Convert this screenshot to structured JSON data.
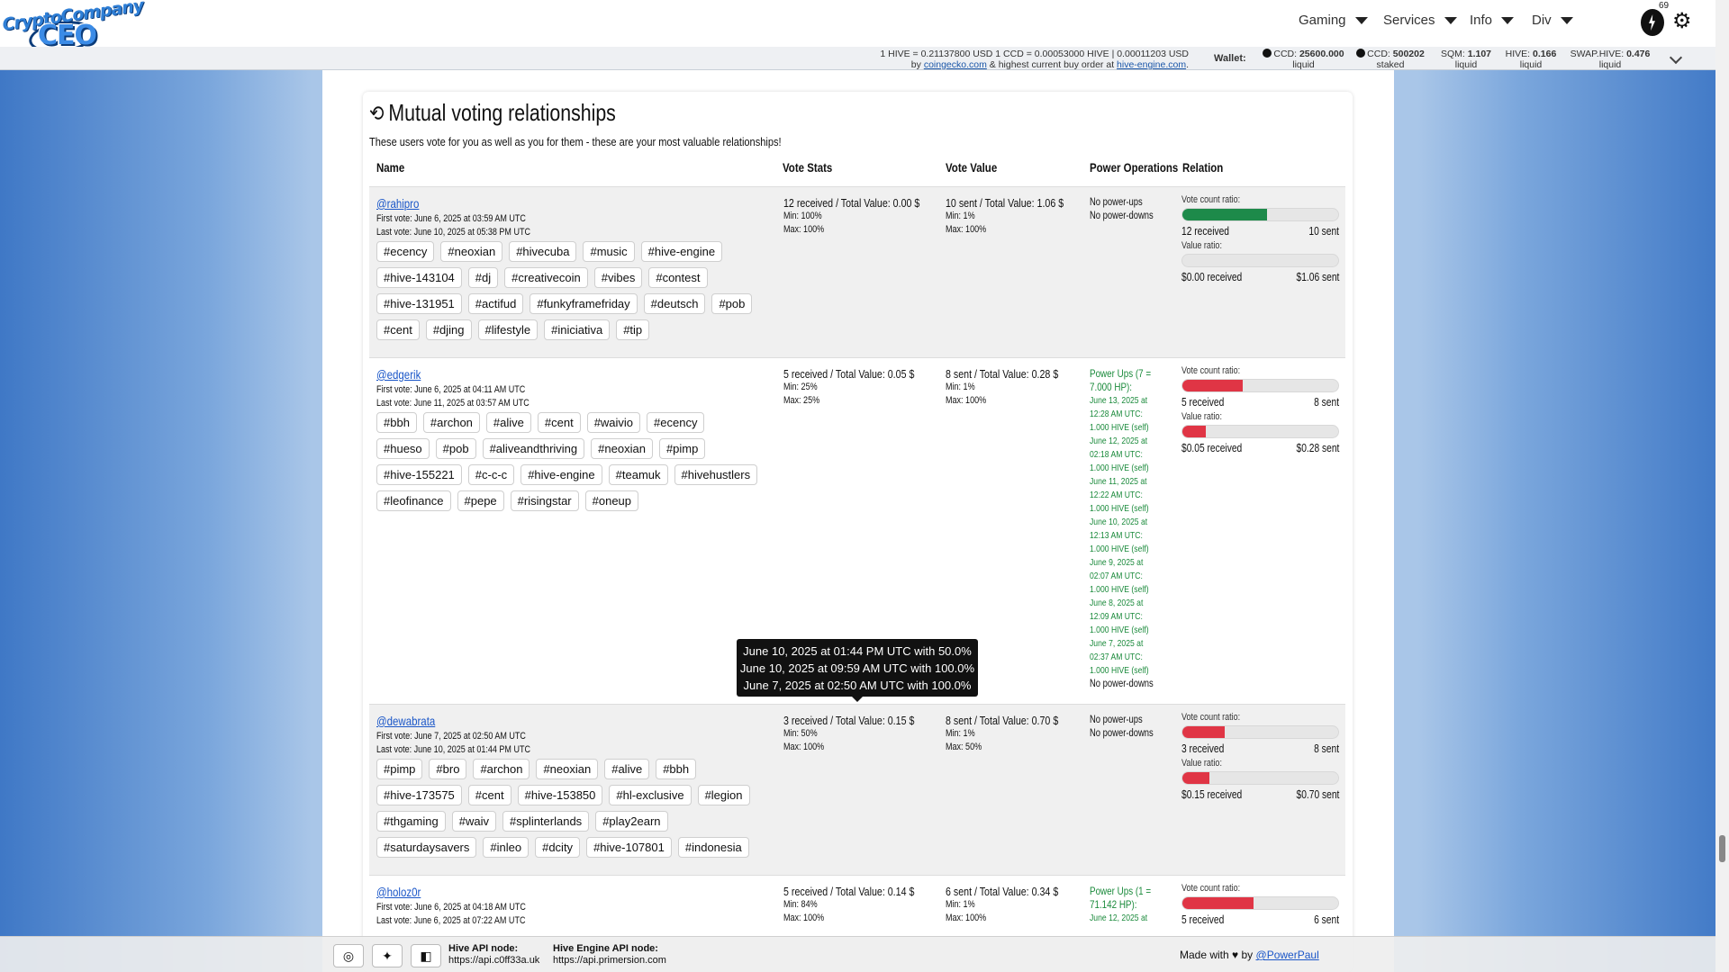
{
  "header": {
    "logo_top": "CryptoCompany",
    "logo_bottom": "CEO",
    "nav": [
      {
        "label": "Gaming"
      },
      {
        "label": "Services"
      },
      {
        "label": "Info"
      },
      {
        "label": "Div"
      }
    ],
    "notification_count": "69"
  },
  "prices": {
    "line1": "1 HIVE = 0.21137800 USD     1 CCD = 0.00053000 HIVE | 0.00011203 USD",
    "by": "by",
    "coingecko": "coingecko.com",
    "middle": "& highest current buy order at",
    "hive_engine": "hive-engine.com",
    "end": "."
  },
  "wallet": {
    "label": "Wallet:",
    "items": [
      {
        "name": "CCD:",
        "value": "25600.000",
        "sub": "liquid"
      },
      {
        "name": "CCD:",
        "value": "500202",
        "sub": "staked"
      },
      {
        "name": "SQM:",
        "value": "1.107",
        "sub": "liquid"
      },
      {
        "name": "HIVE:",
        "value": "0.166",
        "sub": "liquid"
      },
      {
        "name": "SWAP.HIVE:",
        "value": "0.476",
        "sub": "liquid"
      }
    ]
  },
  "section": {
    "title": "Mutual voting relationships",
    "intro": "These users vote for you as well as you for them - these are your most valuable relationships!",
    "columns": [
      "Name",
      "Vote Stats",
      "Vote Value",
      "Power Operations",
      "Relation"
    ]
  },
  "rows": [
    {
      "user": "@rahipro",
      "first_vote": "First vote: June 6, 2025 at 03:59 AM UTC",
      "last_vote": "Last vote: June 10, 2025 at 05:38 PM UTC",
      "tags": [
        "#ecency",
        "#neoxian",
        "#hivecuba",
        "#music",
        "#hive-engine",
        "#hive-143104",
        "#dj",
        "#creativecoin",
        "#vibes",
        "#contest",
        "#hive-131951",
        "#actifud",
        "#funkyframefriday",
        "#deutsch",
        "#pob",
        "#cent",
        "#djing",
        "#lifestyle",
        "#iniciativa",
        "#tip"
      ],
      "vote_stats": "12 received / Total Value: 0.00 $",
      "vs_min": "Min: 100%",
      "vs_max": "Max: 100%",
      "vote_value": "10 sent / Total Value: 1.06 $",
      "vv_min": "Min: 1%",
      "vv_max": "Max: 100%",
      "power_title": "",
      "power_title2": "",
      "power_entries": [],
      "power_lines": [
        "No power-ups",
        "No power-downs"
      ],
      "count_label": "Vote count ratio:",
      "count_fill": 0.545,
      "count_color": "#1d8a4a",
      "received": "12 received",
      "sent": "10 sent",
      "value_label": "Value ratio:",
      "value_fill": 0.0,
      "value_color": "#e03545",
      "value_received": "$0.00 received",
      "value_sent": "$1.06 sent"
    },
    {
      "user": "@edgerik",
      "first_vote": "First vote: June 6, 2025 at 04:11 AM UTC",
      "last_vote": "Last vote: June 11, 2025 at 03:57 AM UTC",
      "tags": [
        "#bbh",
        "#archon",
        "#alive",
        "#cent",
        "#waivio",
        "#ecency",
        "#hueso",
        "#pob",
        "#aliveandthriving",
        "#neoxian",
        "#pimp",
        "#hive-155221",
        "#c-c-c",
        "#hive-engine",
        "#teamuk",
        "#hivehustlers",
        "#leofinance",
        "#pepe",
        "#risingstar",
        "#oneup"
      ],
      "vote_stats": "5 received / Total Value: 0.05 $",
      "vs_min": "Min: 25%",
      "vs_max": "Max: 25%",
      "vote_value": "8 sent / Total Value: 0.28 $",
      "vv_min": "Min: 1%",
      "vv_max": "Max: 100%",
      "power_title": "Power Ups (7 =",
      "power_title2": "7.000 HP):",
      "power_entries": [
        "June 13, 2025 at 12:28 AM UTC: 1.000 HIVE (self)",
        "June 12, 2025 at 02:18 AM UTC: 1.000 HIVE (self)",
        "June 11, 2025 at 12:22 AM UTC: 1.000 HIVE (self)",
        "June 10, 2025 at 12:13 AM UTC: 1.000 HIVE (self)",
        "June 9, 2025 at 02:07 AM UTC: 1.000 HIVE (self)",
        "June 8, 2025 at 12:09 AM UTC: 1.000 HIVE (self)",
        "June 7, 2025 at 02:37 AM UTC: 1.000 HIVE (self)"
      ],
      "power_lines": [
        "No power-downs"
      ],
      "count_label": "Vote count ratio:",
      "count_fill": 0.385,
      "count_color": "#e03545",
      "received": "5 received",
      "sent": "8 sent",
      "value_label": "Value ratio:",
      "value_fill": 0.152,
      "value_color": "#e03545",
      "value_received": "$0.05 received",
      "value_sent": "$0.28 sent"
    },
    {
      "user": "@dewabrata",
      "first_vote": "First vote: June 7, 2025 at 02:50 AM UTC",
      "last_vote": "Last vote: June 10, 2025 at 01:44 PM UTC",
      "tags": [
        "#pimp",
        "#bro",
        "#archon",
        "#neoxian",
        "#alive",
        "#bbh",
        "#hive-173575",
        "#cent",
        "#hive-153850",
        "#hl-exclusive",
        "#legion",
        "#thgaming",
        "#waiv",
        "#splinterlands",
        "#play2earn",
        "#saturdaysavers",
        "#inleo",
        "#dcity",
        "#hive-107801",
        "#indonesia"
      ],
      "vote_stats": "3 received / Total Value: 0.15 $",
      "vs_min": "Min: 50%",
      "vs_max": "Max: 100%",
      "vote_value": "8 sent / Total Value: 0.70 $",
      "vv_min": "Min: 1%",
      "vv_max": "Max: 50%",
      "power_title": "",
      "power_title2": "",
      "power_entries": [],
      "power_lines": [
        "No power-ups",
        "No power-downs"
      ],
      "count_label": "Vote count ratio:",
      "count_fill": 0.273,
      "count_color": "#e03545",
      "received": "3 received",
      "sent": "8 sent",
      "value_label": "Value ratio:",
      "value_fill": 0.176,
      "value_color": "#e03545",
      "value_received": "$0.15 received",
      "value_sent": "$0.70 sent"
    },
    {
      "user": "@holoz0r",
      "first_vote": "First vote: June 6, 2025 at 04:18 AM UTC",
      "last_vote": "Last vote: June 6, 2025 at 07:22 AM UTC",
      "tags": [],
      "vote_stats": "5 received / Total Value: 0.14 $",
      "vs_min": "Min: 84%",
      "vs_max": "Max: 100%",
      "vote_value": "6 sent / Total Value: 0.34 $",
      "vv_min": "Min: 1%",
      "vv_max": "Max: 100%",
      "power_title": "Power Ups (1 =",
      "power_title2": "71.142 HP):",
      "power_entries": [
        "June 12, 2025 at"
      ],
      "power_lines": [],
      "count_label": "Vote count ratio:",
      "count_fill": 0.455,
      "count_color": "#e03545",
      "received": "5 received",
      "sent": "6 sent",
      "value_label": "",
      "value_fill": 0.0,
      "value_color": "#e03545",
      "value_received": "",
      "value_sent": ""
    }
  ],
  "tooltip": [
    "June 10, 2025 at 01:44 PM UTC with 50.0%",
    "June 10, 2025 at 09:59 AM UTC with 100.0%",
    "June 7, 2025 at 02:50 AM UTC with 100.0%"
  ],
  "footer": {
    "hive_label": "Hive API node:",
    "hive_url": "https://api.c0ff33a.uk",
    "engine_label": "Hive Engine API node:",
    "engine_url": "https://api.primersion.com",
    "made_with": "Made with ♥ by",
    "author": "@PowerPaul"
  },
  "icons": {
    "refresh": "refresh-icon",
    "discord": "discord-icon",
    "twitter": "twitter-icon",
    "twitch": "twitch-icon"
  }
}
